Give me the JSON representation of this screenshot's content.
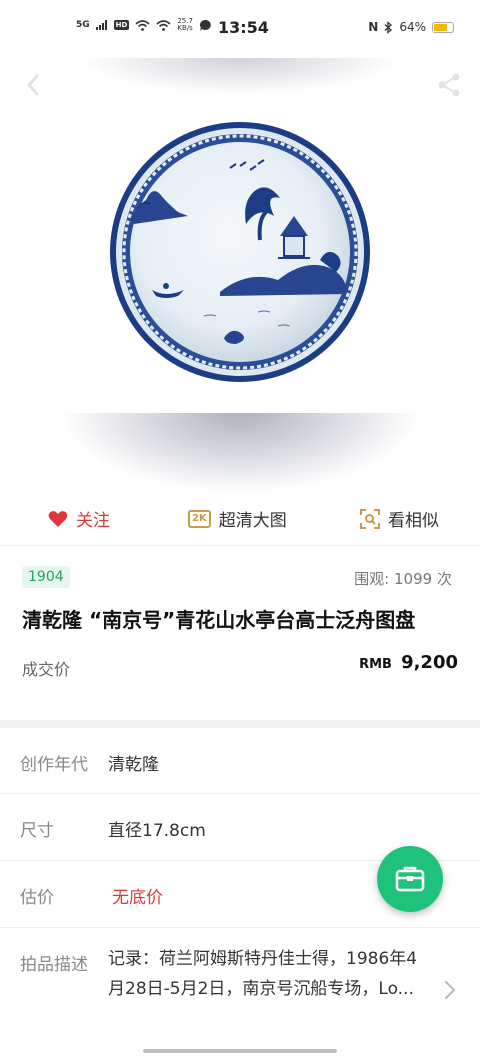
{
  "status_bar": {
    "network": "5G",
    "hd": "HD",
    "speed_value": "25.7",
    "speed_unit": "KB/s",
    "time": "13:54",
    "nfc": "N",
    "battery": "64%",
    "battery_level": 0.64,
    "battery_color": "#f5b800"
  },
  "hero": {
    "back_icon": "chevron-left-icon",
    "share_icon": "share-icon"
  },
  "actions": {
    "follow_label": "关注",
    "hd_badge": "2K",
    "hd_label": "超清大图",
    "similar_label": "看相似",
    "follow_color": "#d53b3b"
  },
  "lot": {
    "number": "1904",
    "views_label": "围观:",
    "views_count": "1099",
    "views_unit": "次",
    "title": "清乾隆 “南京号”青花山水亭台高士泛舟图盘",
    "deal_label": "成交价",
    "currency": "RMB",
    "price": "9,200"
  },
  "details": {
    "era_label": "创作年代",
    "era_value": "清乾隆",
    "size_label": "尺寸",
    "size_value": "直径17.8cm",
    "estimate_label": "估价",
    "estimate_value": "无底价",
    "desc_label": "拍品描述",
    "desc_value": "记录：荷兰阿姆斯特丹佳士得，1986年4月28日-5月2日，南京号沉船专场，Lo..."
  },
  "colors": {
    "accent_green": "#1ec27a",
    "badge_green": "#23a36a",
    "red": "#d53b3b",
    "cobalt": "#1d3c86"
  }
}
